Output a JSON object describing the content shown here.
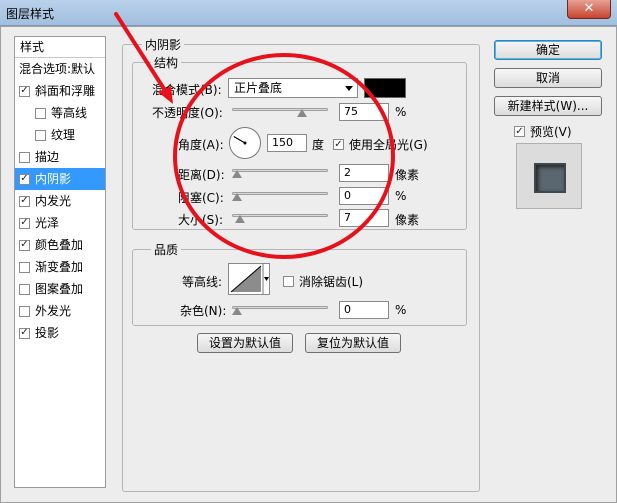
{
  "window": {
    "title": "图层样式",
    "close_glyph": "✕"
  },
  "styles_list": {
    "header": "样式",
    "blending_options": "混合选项:默认",
    "items": [
      {
        "label": "斜面和浮雕",
        "checked": true
      },
      {
        "label": "等高线",
        "checked": false,
        "indent": true
      },
      {
        "label": "纹理",
        "checked": false,
        "indent": true
      },
      {
        "label": "描边",
        "checked": false
      },
      {
        "label": "内阴影",
        "checked": true,
        "selected": true
      },
      {
        "label": "内发光",
        "checked": true
      },
      {
        "label": "光泽",
        "checked": true
      },
      {
        "label": "颜色叠加",
        "checked": true
      },
      {
        "label": "渐变叠加",
        "checked": false
      },
      {
        "label": "图案叠加",
        "checked": false
      },
      {
        "label": "外发光",
        "checked": false
      },
      {
        "label": "投影",
        "checked": true
      }
    ]
  },
  "inner_shadow": {
    "title": "内阴影",
    "structure": {
      "title": "结构",
      "blend_mode_label": "混合模式(B):",
      "blend_mode_value": "正片叠底",
      "color": "#000000",
      "opacity_label": "不透明度(O):",
      "opacity_value": "75",
      "opacity_unit": "%",
      "opacity_fraction": 0.75,
      "angle_label": "角度(A):",
      "angle_value": "150",
      "angle_unit": "度",
      "use_global_light_label": "使用全局光(G)",
      "use_global_light": true,
      "distance_label": "距离(D):",
      "distance_value": "2",
      "distance_unit": "像素",
      "distance_fraction": 0.0,
      "choke_label": "阻塞(C):",
      "choke_value": "0",
      "choke_unit": "%",
      "choke_fraction": 0.0,
      "size_label": "大小(S):",
      "size_value": "7",
      "size_unit": "像素",
      "size_fraction": 0.03
    },
    "quality": {
      "title": "品质",
      "contour_label": "等高线:",
      "anti_alias_label": "消除锯齿(L)",
      "anti_alias": false,
      "noise_label": "杂色(N):",
      "noise_value": "0",
      "noise_unit": "%",
      "noise_fraction": 0.0
    },
    "make_default_label": "设置为默认值",
    "reset_default_label": "复位为默认值"
  },
  "actions": {
    "ok_label": "确定",
    "cancel_label": "取消",
    "new_style_label": "新建样式(W)...",
    "preview_label": "预览(V)",
    "preview_checked": true
  },
  "annotation_color": "#e8111b"
}
